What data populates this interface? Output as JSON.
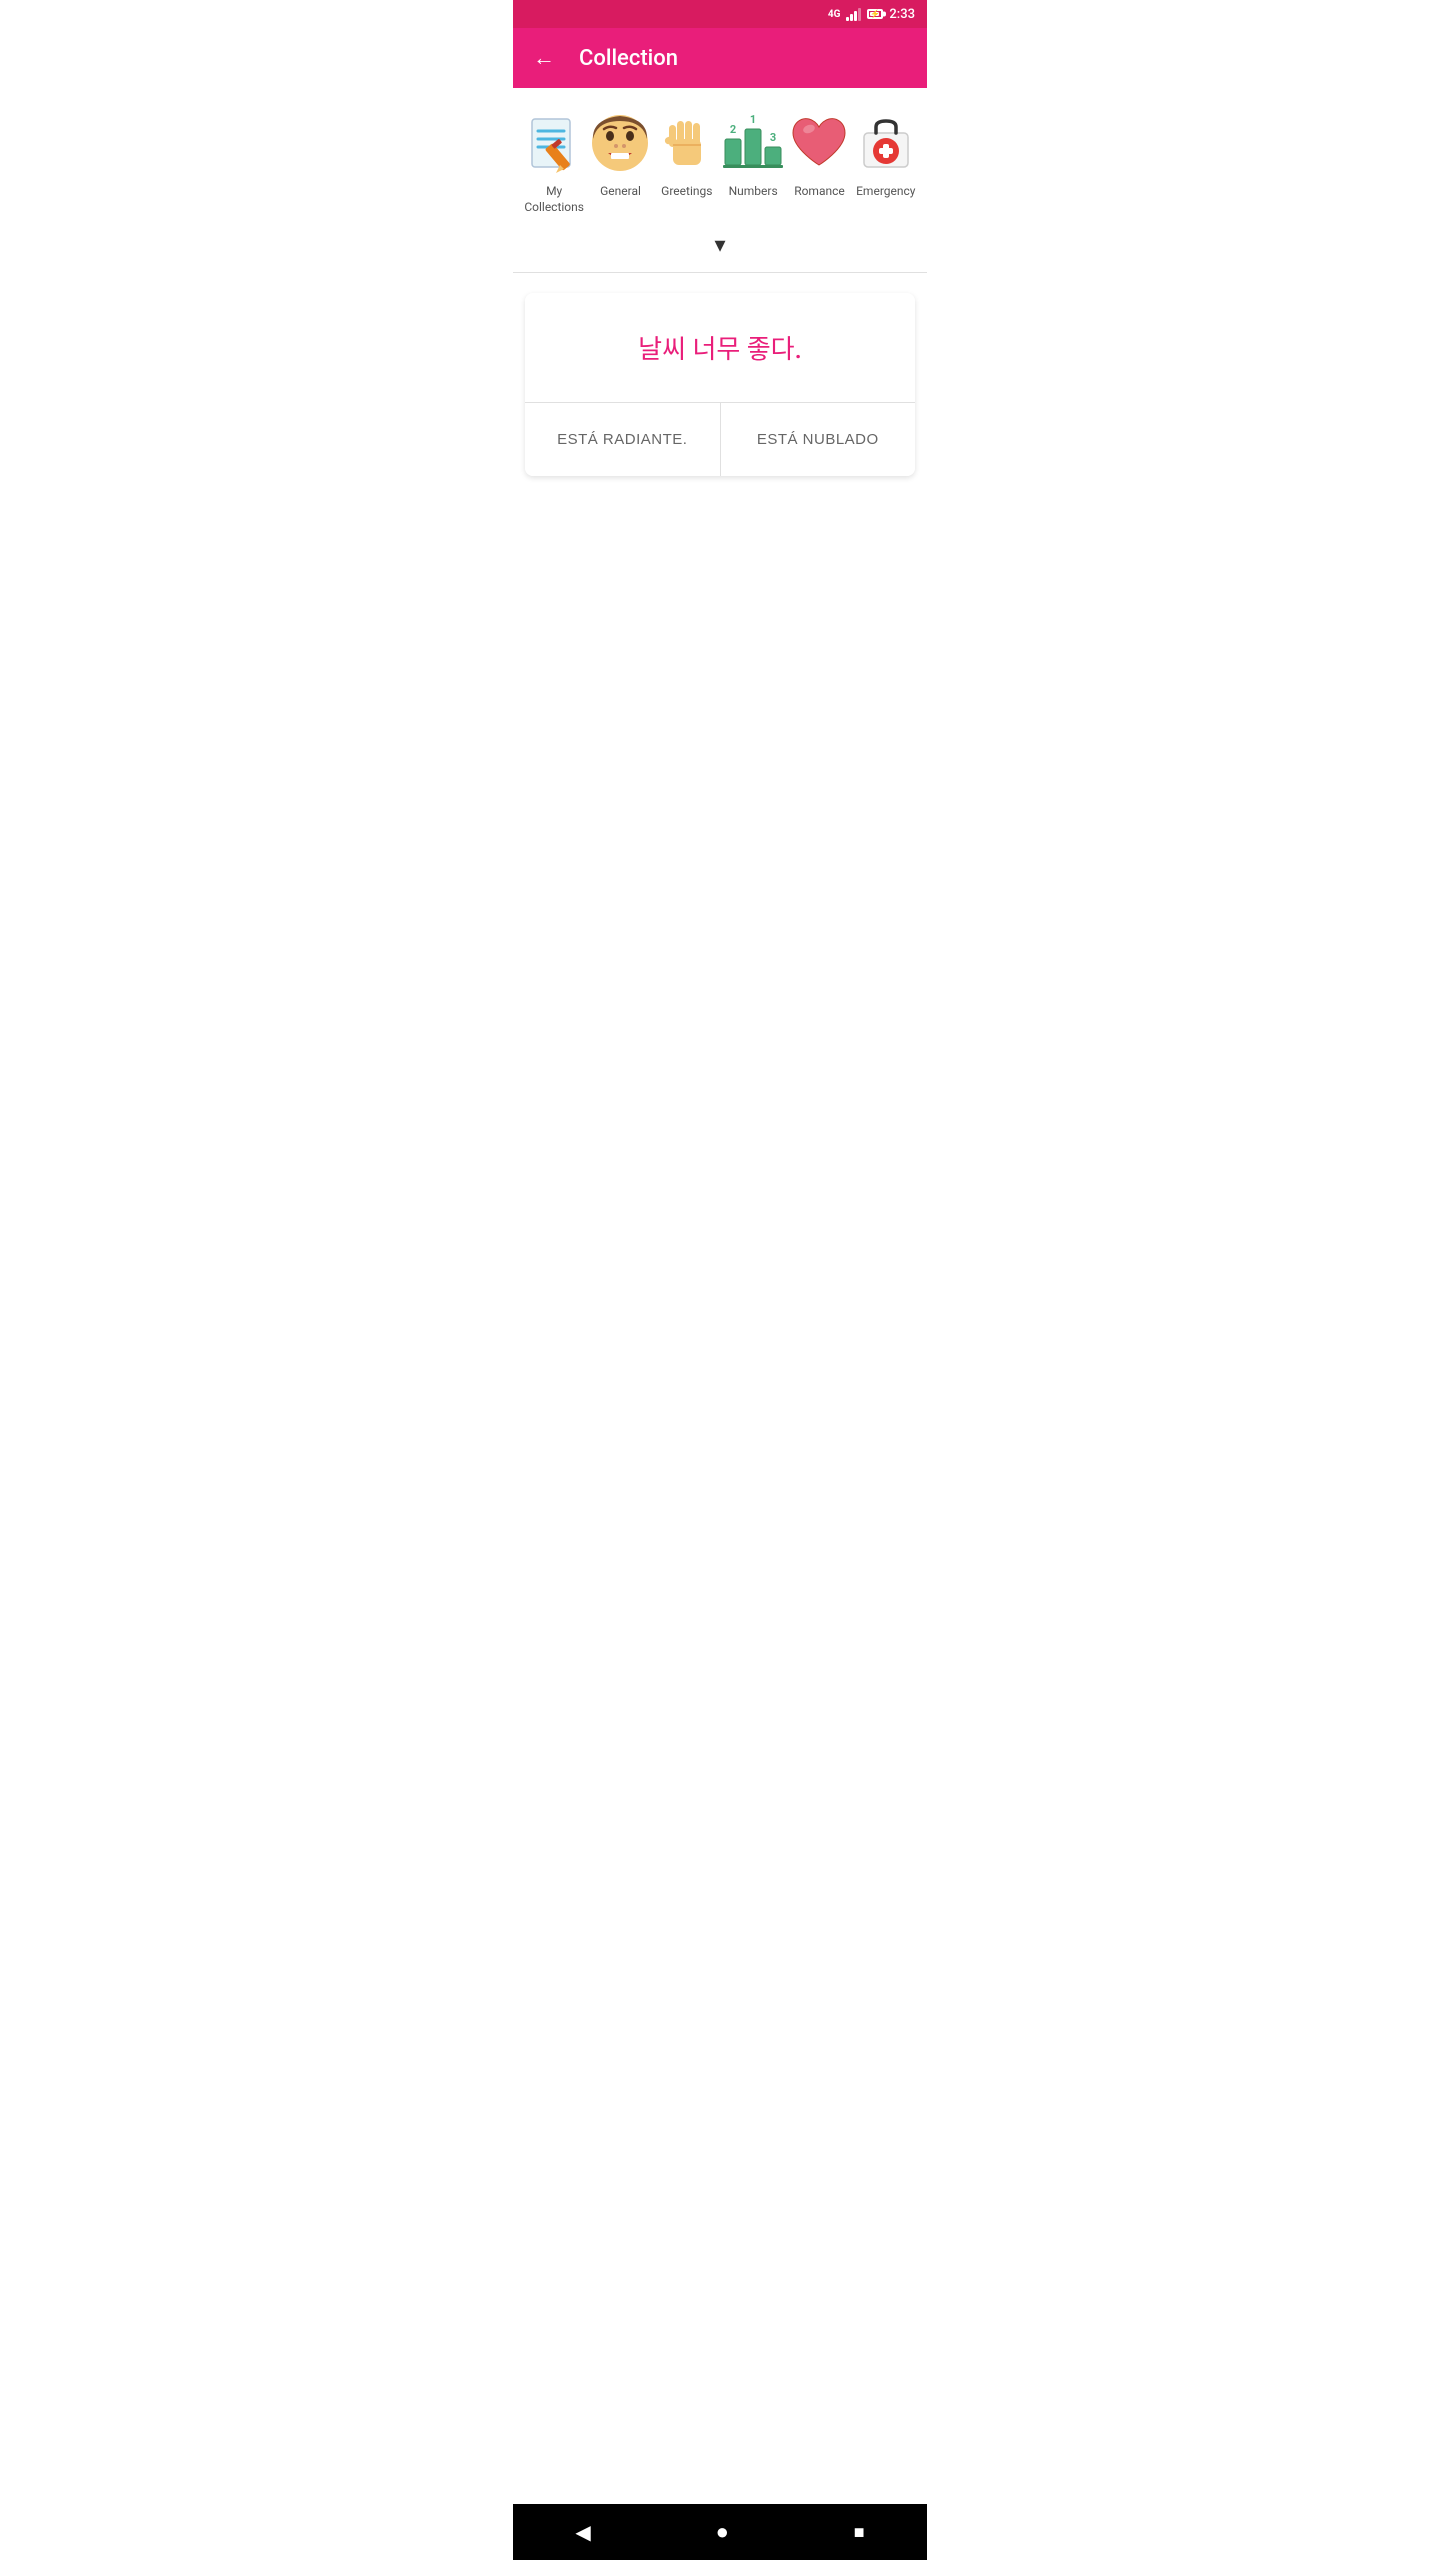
{
  "statusBar": {
    "network": "4G",
    "time": "2:33"
  },
  "appBar": {
    "title": "Collection",
    "backLabel": "←"
  },
  "categories": [
    {
      "id": "my-collections",
      "label": "My Collections",
      "iconType": "pencil-paper"
    },
    {
      "id": "general",
      "label": "General",
      "iconType": "face"
    },
    {
      "id": "greetings",
      "label": "Greetings",
      "iconType": "hand-wave"
    },
    {
      "id": "numbers",
      "label": "Numbers",
      "iconType": "numbers"
    },
    {
      "id": "romance",
      "label": "Romance",
      "iconType": "heart"
    },
    {
      "id": "emergency",
      "label": "Emergency",
      "iconType": "medical-kit"
    }
  ],
  "chevron": "▾",
  "quizCard": {
    "question": "날씨 너무 좋다.",
    "answers": [
      {
        "id": "answer-a",
        "text": "ESTÁ RADIANTE."
      },
      {
        "id": "answer-b",
        "text": "ESTÁ NUBLADO"
      }
    ]
  },
  "bottomNav": {
    "back": "◀",
    "home": "●",
    "recent": "■"
  }
}
